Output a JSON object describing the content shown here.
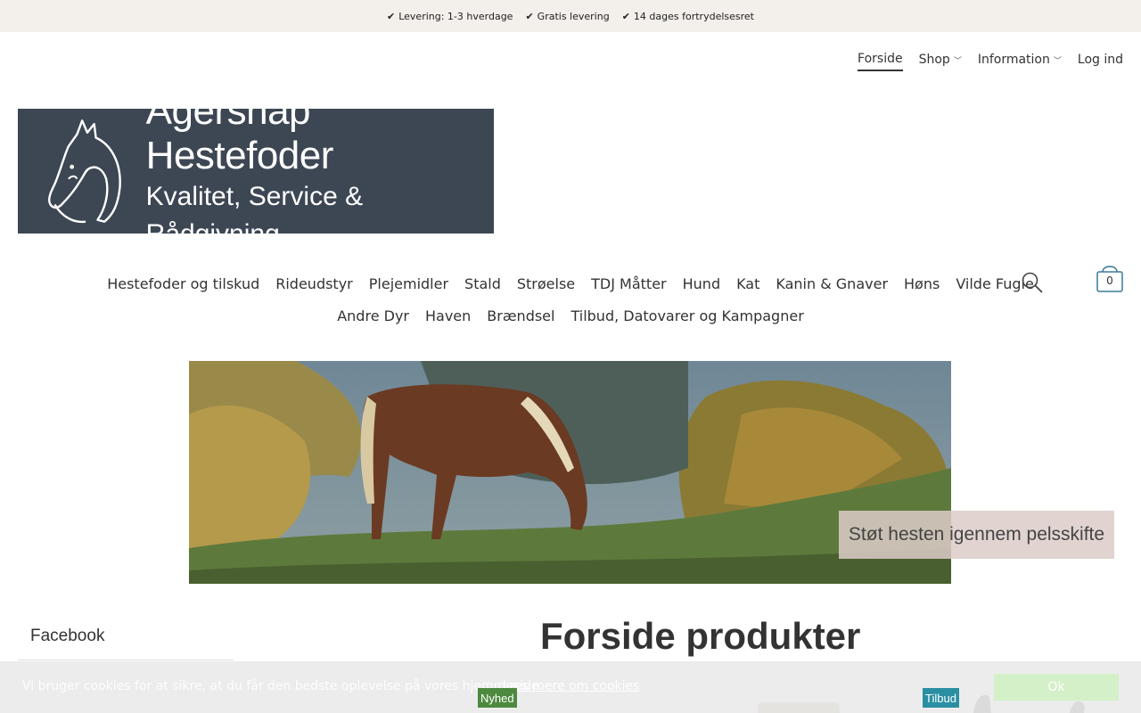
{
  "topbar": {
    "usps": [
      "Levering: 1-3 hverdage",
      "Gratis levering",
      "14 dages fortrydelsesret"
    ]
  },
  "utilnav": {
    "forside": "Forside",
    "shop": "Shop",
    "information": "Information",
    "login": "Log ind"
  },
  "logo": {
    "line1": "Agersnap Hestefoder",
    "line2": "Kvalitet, Service & Rådgivning"
  },
  "mainnav": {
    "row1": [
      "Hestefoder og tilskud",
      "Rideudstyr",
      "Plejemidler",
      "Stald",
      "Strøelse",
      "TDJ Måtter",
      "Hund",
      "Kat",
      "Kanin & Gnaver",
      "Høns",
      "Vilde Fugle"
    ],
    "row2": [
      "Andre Dyr",
      "Haven",
      "Brændsel",
      "Tilbud, Datovarer og Kampagner"
    ]
  },
  "cart": {
    "count": "0"
  },
  "hero": {
    "caption": "Støt hesten igennem pelsskifte"
  },
  "sidebar": {
    "facebook_title": "Facebook"
  },
  "products": {
    "title": "Forside produkter",
    "badge_new": "Nyhed",
    "badge_offer": "Tilbud"
  },
  "cookie": {
    "message": "Vi bruger cookies for at sikre, at du får den bedste oplevelse på vores hjemmeside.",
    "more": "Læs mere om cookies",
    "ok": "Ok"
  },
  "colors": {
    "topbar_bg": "#f3efea",
    "logo_bg": "#3d4754",
    "badge_new": "#4d8a3e",
    "badge_offer": "#2a8fa3",
    "cookie_ok": "#d4f0c8"
  }
}
